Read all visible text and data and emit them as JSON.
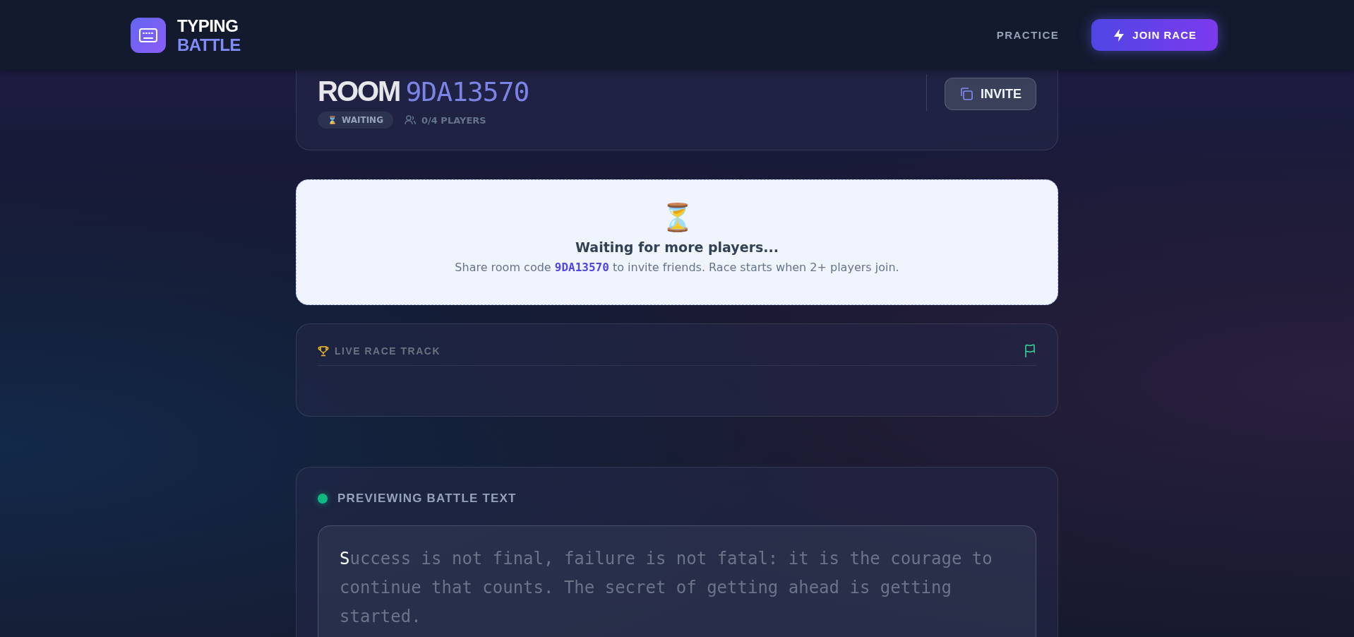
{
  "header": {
    "logo_top": "TYPING",
    "logo_bottom": "BATTLE",
    "nav": [
      {
        "label": "PRACTICE",
        "kind": "link"
      },
      {
        "label": "JOIN RACE",
        "kind": "primary"
      }
    ]
  },
  "room": {
    "label": "ROOM",
    "code": "9DA13570",
    "status_icon": "⌛",
    "status": "WAITING",
    "players": "0/4 PLAYERS",
    "invite": "INVITE"
  },
  "waiting": {
    "icon": "⏳",
    "title": "Waiting for more players...",
    "hint_before": "Share room code ",
    "hint_code": "9DA13570",
    "hint_after": " to invite friends. Race starts when 2+ players join."
  },
  "track": {
    "title": "LIVE RACE TRACK"
  },
  "preview": {
    "title": "PREVIEWING BATTLE TEXT",
    "cursor_char": "S",
    "remaining": "uccess is not final, failure is not fatal: it is the courage to continue that counts. The secret of getting ahead is getting started."
  }
}
